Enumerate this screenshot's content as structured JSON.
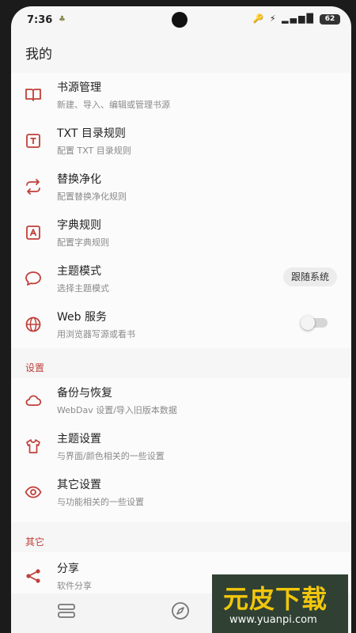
{
  "status": {
    "time": "7:36",
    "icons": "🔑 ⚡ ▂▄▆█",
    "battery": "62"
  },
  "page_title": "我的",
  "main_items": [
    {
      "icon": "book-icon",
      "title": "书源管理",
      "subtitle": "新建、导入、编辑或管理书源"
    },
    {
      "icon": "txt-icon",
      "title": "TXT 目录规则",
      "subtitle": "配置 TXT 目录规则"
    },
    {
      "icon": "replace-icon",
      "title": "替换净化",
      "subtitle": "配置替换净化规则"
    },
    {
      "icon": "dictionary-icon",
      "title": "字典规则",
      "subtitle": "配置字典规则"
    },
    {
      "icon": "theme-mode-icon",
      "title": "主题模式",
      "subtitle": "选择主题模式",
      "chip": "跟随系统"
    },
    {
      "icon": "web-globe-icon",
      "title": "Web 服务",
      "subtitle": "用浏览器写源或看书",
      "toggle_on": false
    }
  ],
  "settings_section": "设置",
  "settings_items": [
    {
      "icon": "cloud-icon",
      "title": "备份与恢复",
      "subtitle": "WebDav 设置/导入旧版本数据"
    },
    {
      "icon": "shirt-icon",
      "title": "主题设置",
      "subtitle": "与界面/颜色相关的一些设置"
    },
    {
      "icon": "eye-icon",
      "title": "其它设置",
      "subtitle": "与功能相关的一些设置"
    }
  ],
  "other_section": "其它",
  "other_items": [
    {
      "icon": "share-icon",
      "title": "分享",
      "subtitle": "软件分享"
    }
  ],
  "watermark": {
    "text": "元皮下载",
    "url": "www.yuanpi.com"
  },
  "accent_color": "#c0403a"
}
